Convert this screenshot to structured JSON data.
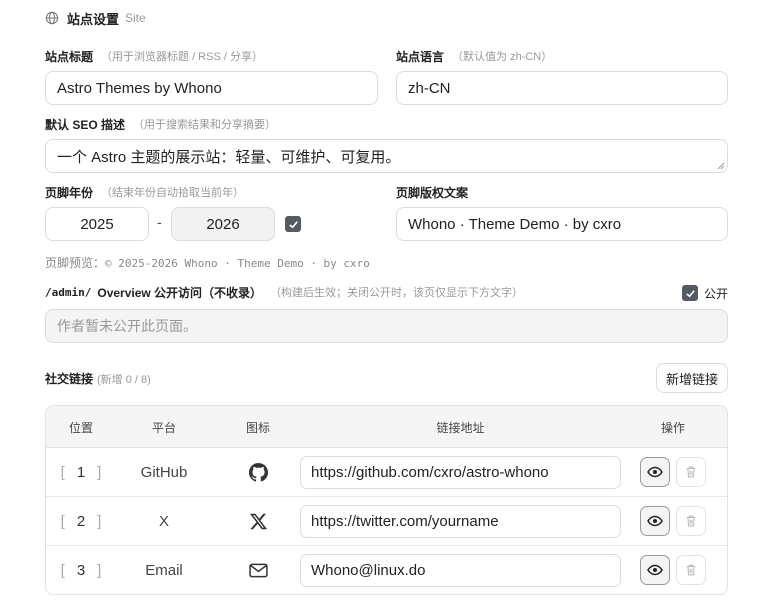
{
  "section": {
    "title": "站点设置",
    "subtitle": "Site"
  },
  "site_title": {
    "label": "站点标题",
    "hint": "（用于浏览器标题 / RSS / 分享）",
    "value": "Astro Themes by Whono"
  },
  "site_lang": {
    "label": "站点语言",
    "hint": "（默认值为 zh-CN）",
    "value": "zh-CN"
  },
  "seo": {
    "label": "默认 SEO 描述",
    "hint": "（用于搜索结果和分享摘要）",
    "value": "一个 Astro 主题的展示站：轻量、可维护、可复用。"
  },
  "footer_year": {
    "label": "页脚年份",
    "hint": "（结束年份自动拾取当前年）",
    "start": "2025",
    "separator": "-",
    "end": "2026",
    "auto_checked": true
  },
  "footer_copy": {
    "label": "页脚版权文案",
    "value": "Whono · Theme Demo · by cxro"
  },
  "footer_preview": {
    "prefix": "页脚预览：",
    "text": "© 2025-2026 Whono · Theme Demo · by cxro"
  },
  "admin": {
    "path_label": "/admin/",
    "label": "Overview 公开访问（不收录）",
    "hint": "（构建后生效；关闭公开时，该页仅显示下方文字）",
    "public_label": "公开",
    "public_checked": true,
    "placeholder": "作者暂未公开此页面。"
  },
  "social": {
    "title": "社交链接",
    "count": "(新增 0 / 8)",
    "add_label": "新增链接",
    "columns": {
      "position": "位置",
      "platform": "平台",
      "icon": "图标",
      "url": "链接地址",
      "actions": "操作"
    },
    "rows": [
      {
        "position": "1",
        "platform": "GitHub",
        "icon": "github-icon",
        "url": "https://github.com/cxro/astro-whono"
      },
      {
        "position": "2",
        "platform": "X",
        "icon": "x-icon",
        "url": "https://twitter.com/yourname"
      },
      {
        "position": "3",
        "platform": "Email",
        "icon": "mail-icon",
        "url": "Whono@linux.do"
      }
    ]
  }
}
